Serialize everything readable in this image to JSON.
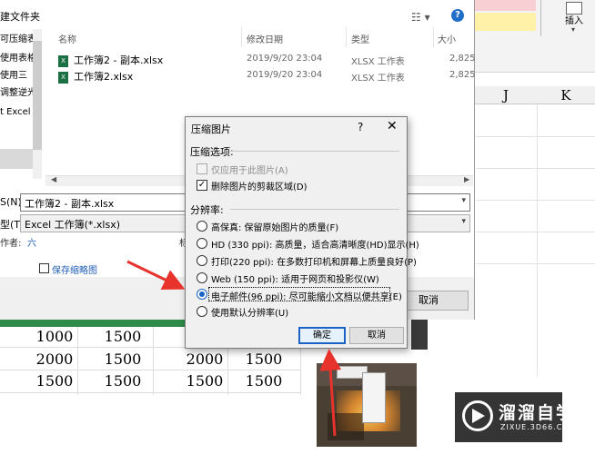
{
  "excel": {
    "insert_label": "插入",
    "columns": [
      "J",
      "K"
    ],
    "grid_rows": [
      [
        "1000",
        "1500",
        "",
        ""
      ],
      [
        "2000",
        "1500",
        "2000",
        "1500"
      ],
      [
        "1500",
        "1500",
        "1500",
        "1500"
      ]
    ]
  },
  "file_dialog": {
    "title": "建文件夹",
    "nav_items": [
      "可压缩表",
      "使用表格",
      "使用三",
      "调整逆光",
      "t Excel",
      ""
    ],
    "columns": {
      "name": "名称",
      "modified": "修改日期",
      "type": "类型",
      "size": "大小"
    },
    "files": [
      {
        "name": "工作簿2 - 副本.xlsx",
        "modified": "2019/9/20 23:04",
        "type": "XLSX 工作表",
        "size": "2,825"
      },
      {
        "name": "工作簿2.xlsx",
        "modified": "2019/9/20 23:04",
        "type": "XLSX 工作表",
        "size": "2,825"
      }
    ],
    "filename_label": "S(N):",
    "filename_value": "工作簿2 - 副本.xlsx",
    "filetype_label": "型(T):",
    "filetype_value": "Excel 工作簿(*.xlsx)",
    "author_label": "作者:",
    "author_value": "六",
    "tag_label": "标",
    "thumbnail_label": "保存缩略图",
    "cancel": "取消"
  },
  "compress_dialog": {
    "title": "压缩图片",
    "help": "?",
    "close": "✕",
    "options_section": "压缩选项:",
    "apply_only": "仅应用于此图片(A)",
    "delete_cropped": "删除图片的剪裁区域(D)",
    "resolution_section": "分辨率:",
    "resolutions": [
      "高保真: 保留原始图片的质量(F)",
      "HD (330 ppi): 高质量，适合高清晰度(HD)显示(H)",
      "打印(220 ppi): 在多数打印机和屏幕上质量良好(P)",
      "Web (150 ppi): 适用于网页和投影仪(W)",
      "电子邮件(96 ppi): 尽可能缩小文档以便共享(E)",
      "使用默认分辨率(U)"
    ],
    "selected_index": 4,
    "ok": "确定",
    "cancel": "取消"
  },
  "watermark": {
    "title": "溜溜自学",
    "url": "ZIXUE.3D66.COM"
  },
  "colors": {
    "accent": "#1a63c4",
    "arrow": "#e8322c",
    "green_row": "#2e8b4a"
  }
}
